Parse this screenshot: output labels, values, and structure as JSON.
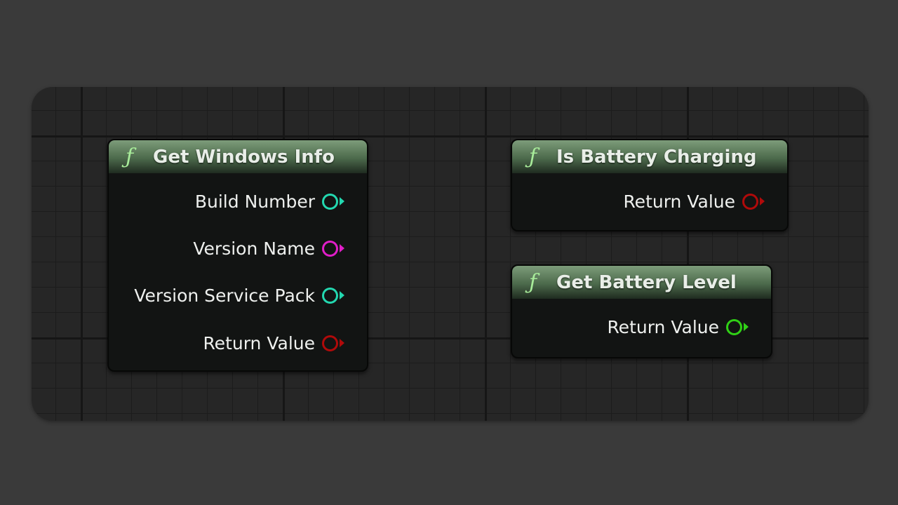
{
  "colors": {
    "int": "#23d8b0",
    "string": "#e01ec8",
    "bool": "#b00a0a",
    "float": "#30d016",
    "func_icon": "#a8ec9a"
  },
  "nodes": {
    "windows": {
      "icon": "function-icon",
      "title": "Get Windows Info",
      "pins": [
        {
          "label": "Build Number",
          "type": "int"
        },
        {
          "label": "Version Name",
          "type": "string"
        },
        {
          "label": "Version Service Pack",
          "type": "int"
        },
        {
          "label": "Return Value",
          "type": "bool"
        }
      ]
    },
    "charging": {
      "icon": "function-icon",
      "title": "Is Battery Charging",
      "pins": [
        {
          "label": "Return Value",
          "type": "bool"
        }
      ]
    },
    "level": {
      "icon": "function-icon",
      "title": "Get Battery Level",
      "pins": [
        {
          "label": "Return Value",
          "type": "float"
        }
      ]
    }
  }
}
